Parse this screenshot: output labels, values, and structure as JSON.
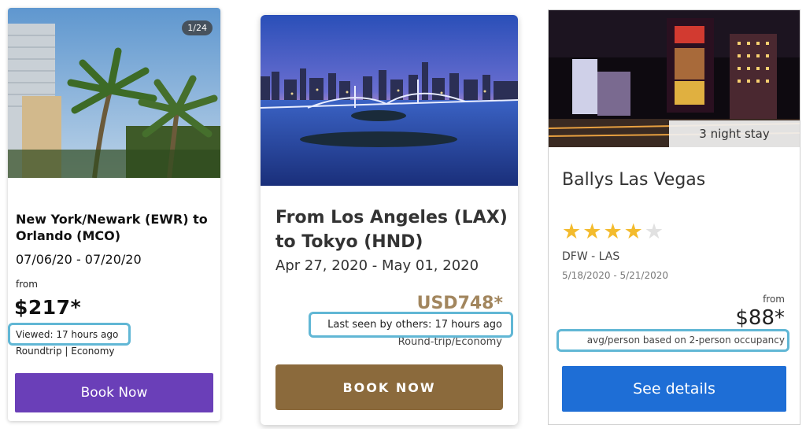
{
  "cards": [
    {
      "photo_counter": "1/24",
      "title": "New York/Newark (EWR) to Orlando (MCO)",
      "dates": "07/06/20 - 07/20/20",
      "from_label": "from",
      "price": "$217*",
      "viewed": "Viewed: 17 hours ago",
      "trip_type": "Roundtrip | Economy",
      "button_label": "Book Now",
      "button_color": "#6a3fb8"
    },
    {
      "title": "From Los Angeles (LAX) to Tokyo (HND)",
      "dates": "Apr 27, 2020 - May 01, 2020",
      "price": "USD748*",
      "seen": "Last seen by others: 17 hours ago",
      "trip_type": "Round-trip/Economy",
      "button_label": "BOOK NOW",
      "button_color": "#8b6a3c",
      "price_color": "#a2865e"
    },
    {
      "stay_badge": "3 night stay",
      "title": "Ballys Las Vegas",
      "rating": 4,
      "rating_max": 5,
      "route": "DFW - LAS",
      "dates": "5/18/2020 - 5/21/2020",
      "from_label": "from",
      "price": "$88*",
      "occupancy": "avg/person based on 2-person occupancy",
      "button_label": "See details",
      "button_color": "#1e6ed6"
    }
  ],
  "highlight_color": "#61b7d5"
}
